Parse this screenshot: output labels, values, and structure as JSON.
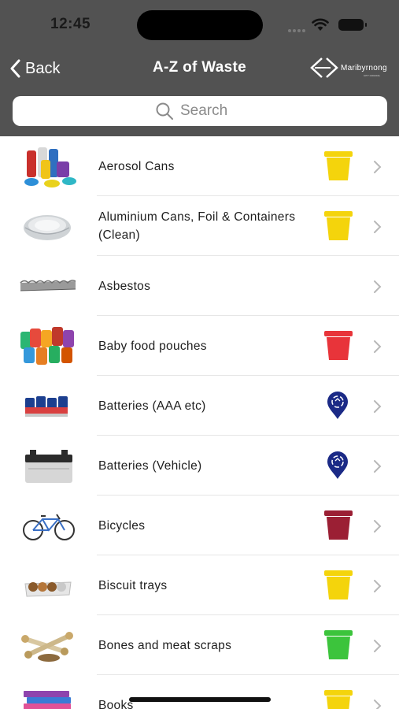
{
  "status": {
    "time": "12:45"
  },
  "nav": {
    "back_label": "Back",
    "title": "A-Z of Waste",
    "logo_text": "Maribyrnong",
    "logo_sub": "CITY COUNCIL"
  },
  "search": {
    "placeholder": "Search"
  },
  "colors": {
    "header": "#525252",
    "yellow_bin": "#f4d40c",
    "red_bin": "#e8343a",
    "maroon_bin": "#9b1f34",
    "green_bin": "#3cc43c",
    "dropoff_pin": "#1b2a86"
  },
  "items": [
    {
      "label": "Aerosol Cans",
      "icon": "yellow-bin-icon"
    },
    {
      "label": "Aluminium Cans, Foil & Containers (Clean)",
      "icon": "yellow-bin-icon"
    },
    {
      "label": "Asbestos",
      "icon": "none"
    },
    {
      "label": "Baby food pouches",
      "icon": "red-bin-icon"
    },
    {
      "label": "Batteries (AAA etc)",
      "icon": "dropoff-pin-icon"
    },
    {
      "label": "Batteries (Vehicle)",
      "icon": "dropoff-pin-icon"
    },
    {
      "label": "Bicycles",
      "icon": "maroon-bin-icon"
    },
    {
      "label": "Biscuit trays",
      "icon": "yellow-bin-icon"
    },
    {
      "label": "Bones and meat scraps",
      "icon": "green-bin-icon"
    },
    {
      "label": "Books",
      "icon": "yellow-bin-icon"
    }
  ]
}
